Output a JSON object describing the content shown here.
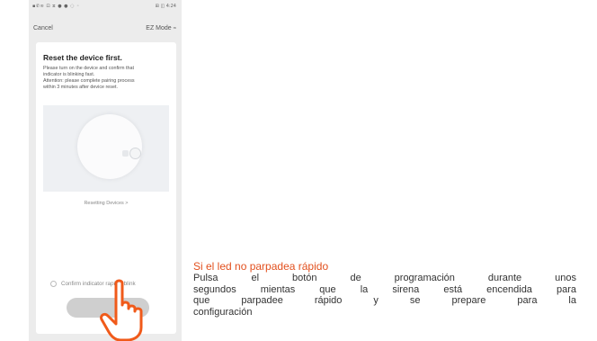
{
  "status_bar": {
    "left": "▪✆≋ ⊡ ⧖ ● ● ◌ ◦",
    "right": "⊞ ◫ 4:24"
  },
  "nav": {
    "cancel_label": "Cancel",
    "mode_label": "EZ Mode",
    "mode_icon": "wifi-icon"
  },
  "card": {
    "title": "Reset the device first.",
    "description_lines": [
      "Please turn on the device and confirm that",
      "indicator is blinking fast.",
      "Attention: please complete pairing process",
      "within 3 minutes after device reset."
    ],
    "resetting_link": "Resetting Devices >",
    "confirm_label": "Confirm indicator rapidly blink",
    "next_button_label": ""
  },
  "caption": {
    "title": "Si el led no parpadea rápido",
    "lines": [
      "Pulsa el botón de programación durante unos",
      "segundos mientas que la sirena está encendida para",
      "que parpadee rápido y se prepare para la",
      "configuración"
    ]
  },
  "colors": {
    "caption_title": "#e2501e",
    "hand_outline": "#f05a1a",
    "button": "#cfcfcf"
  }
}
